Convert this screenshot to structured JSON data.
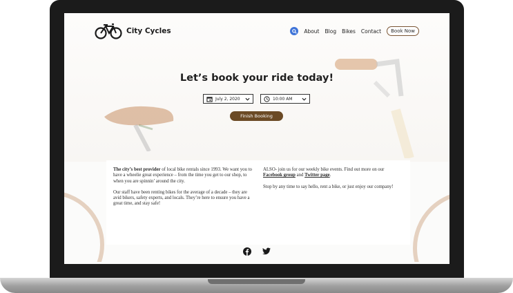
{
  "brand": {
    "name": "City Cycles",
    "logo_icon": "bicycle-icon"
  },
  "nav": {
    "search_icon": "search-icon",
    "links": [
      "About",
      "Blog",
      "Bikes",
      "Contact"
    ],
    "book_now": "Book Now"
  },
  "hero": {
    "title": "Let’s book your ride today!",
    "date_value": "July 2, 2020",
    "time_value": "10:00 AM",
    "date_icon": "calendar-icon",
    "time_icon": "clock-icon",
    "finish_button": "Finish Booking"
  },
  "content": {
    "left": {
      "p1_bold": "The city’s best provider",
      "p1_rest": " of local bike rentals since 1993. We want you to have a wheelie great experience – from the time you get to our shop, to when you are spinnin’ around the city.",
      "p2": "Our staff have been renting bikes for the average of a decade – they are avid bikers, safety experts, and locals. They’re here to ensure you have a great time, and stay safe!"
    },
    "right": {
      "p1_start": "ALSO- join us for our weekly bike events. Find out more on our ",
      "facebook_link": "Facebook group",
      "p1_mid": " and ",
      "twitter_link": "Twitter page",
      "p1_end": ".",
      "p2": "Stop by any time to say hello, rent a bike, or just enjoy our company!"
    }
  },
  "footer": {
    "icons": [
      "facebook-icon",
      "twitter-icon"
    ]
  },
  "colors": {
    "accent_brown": "#6b4a25",
    "search_blue": "#3f74d8",
    "frame": "#1b1b1b"
  }
}
